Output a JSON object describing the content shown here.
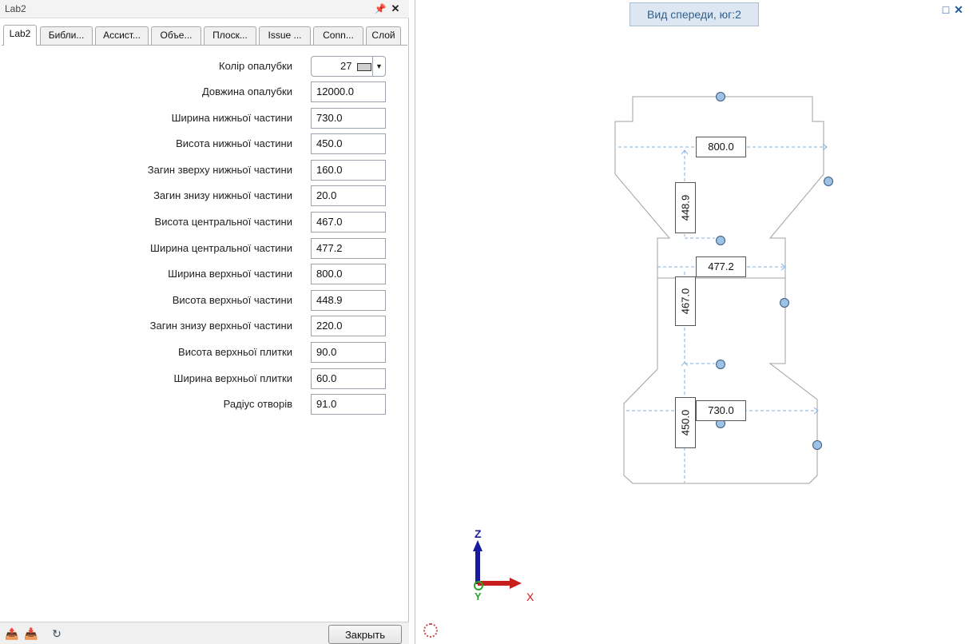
{
  "panel": {
    "title": "Lab2",
    "pin_icon": "pin-icon",
    "close_icon": "close-icon",
    "tabs": [
      {
        "label": "Lab2",
        "active": true
      },
      {
        "label": "Библи...",
        "active": false
      },
      {
        "label": "Ассист...",
        "active": false
      },
      {
        "label": "Объе...",
        "active": false
      },
      {
        "label": "Плоск...",
        "active": false
      },
      {
        "label": "Issue ...",
        "active": false
      },
      {
        "label": "Conn...",
        "active": false
      },
      {
        "label": "Слой",
        "active": false
      }
    ],
    "color_row": {
      "label": "Колір опалубки",
      "value": "27",
      "swatch_color": "#cfcfcf"
    },
    "properties": [
      {
        "label": "Довжина опалубки",
        "value": "12000.0"
      },
      {
        "label": "Ширина нижньої частини",
        "value": "730.0"
      },
      {
        "label": "Висота нижньої частини",
        "value": "450.0"
      },
      {
        "label": "Загин зверху нижньої частини",
        "value": "160.0"
      },
      {
        "label": "Загин знизу нижньої частини",
        "value": "20.0"
      },
      {
        "label": "Висота центральної частини",
        "value": "467.0"
      },
      {
        "label": "Ширина центральної частини",
        "value": "477.2"
      },
      {
        "label": "Ширина верхньої частини",
        "value": "800.0"
      },
      {
        "label": "Висота верхньої частини",
        "value": "448.9"
      },
      {
        "label": "Загин знизу верхньої частини",
        "value": "220.0"
      },
      {
        "label": "Висота верхньої плитки",
        "value": "90.0"
      },
      {
        "label": "Ширина верхньої плитки",
        "value": "60.0"
      },
      {
        "label": "Радіус отворів",
        "value": "91.0"
      }
    ],
    "bottom": {
      "icons": [
        "export-icon",
        "import-icon",
        "reset-icon"
      ],
      "close_label": "Закрыть"
    }
  },
  "viewport": {
    "title": "Вид спереди, юг:2",
    "dimensions": {
      "top_width": "800.0",
      "top_height": "448.9",
      "center_width": "477.2",
      "center_height": "467.0",
      "bottom_width": "730.0",
      "bottom_height": "450.0"
    },
    "axes": {
      "z": "Z",
      "x": "X",
      "y": "Y"
    },
    "colors": {
      "outline": "#a0a0a0",
      "dimension_line": "#7fb2e0",
      "handle_fill": "#9ec1e6",
      "handle_stroke": "#3a5a80",
      "axis_z": "#1a1a9e",
      "axis_x": "#c81e1e",
      "axis_y": "#2aa52a",
      "view_title_bg": "#dde7f2"
    }
  }
}
